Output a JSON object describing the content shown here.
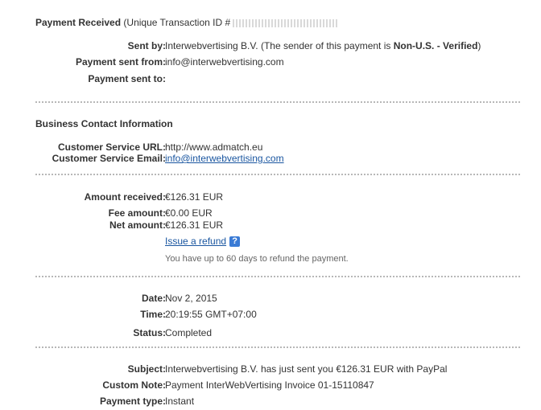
{
  "summary": {
    "title": "Payment Received",
    "txn_prefix": "(Unique Transaction ID #",
    "sent_by_label": "Sent by:",
    "sent_by_name": "Interwebvertising B.V.",
    "sender_note_prefix": "(The sender of this payment is",
    "sender_status": "Non-U.S. - Verified",
    "sender_note_suffix": ")",
    "sent_from_label": "Payment sent from:",
    "sent_from_value": "info@interwebvertising.com",
    "sent_to_label": "Payment sent to:",
    "sent_to_value": ""
  },
  "business": {
    "title": "Business Contact Information",
    "service_url_label": "Customer Service URL:",
    "service_url_value": "http://www.admatch.eu",
    "service_email_label": "Customer Service Email:",
    "service_email_value": "info@interwebvertising.com"
  },
  "amounts": {
    "received_label": "Amount received:",
    "received_value": "€126.31 EUR",
    "fee_label": "Fee amount:",
    "fee_value": "€0.00 EUR",
    "net_label": "Net amount:",
    "net_value": "€126.31 EUR",
    "refund_link": "Issue a refund",
    "help_glyph": "?",
    "refund_note": "You have up to 60 days to refund the payment."
  },
  "details": {
    "date_label": "Date:",
    "date_value": "Nov 2, 2015",
    "time_label": "Time:",
    "time_value": "20:19:55 GMT+07:00",
    "status_label": "Status:",
    "status_value": "Completed"
  },
  "message": {
    "subject_label": "Subject:",
    "subject_value": "Interwebvertising B.V. has just sent you €126.31 EUR with PayPal",
    "note_label": "Custom Note:",
    "note_value": "Payment InterWebVertising Invoice 01-15110847",
    "type_label": "Payment type:",
    "type_value": "Instant"
  },
  "icons": {
    "help": "help-question-icon"
  },
  "colors": {
    "link": "#1a56a0",
    "help_icon": "#3a7bd5",
    "divider": "#b7b7b7"
  }
}
